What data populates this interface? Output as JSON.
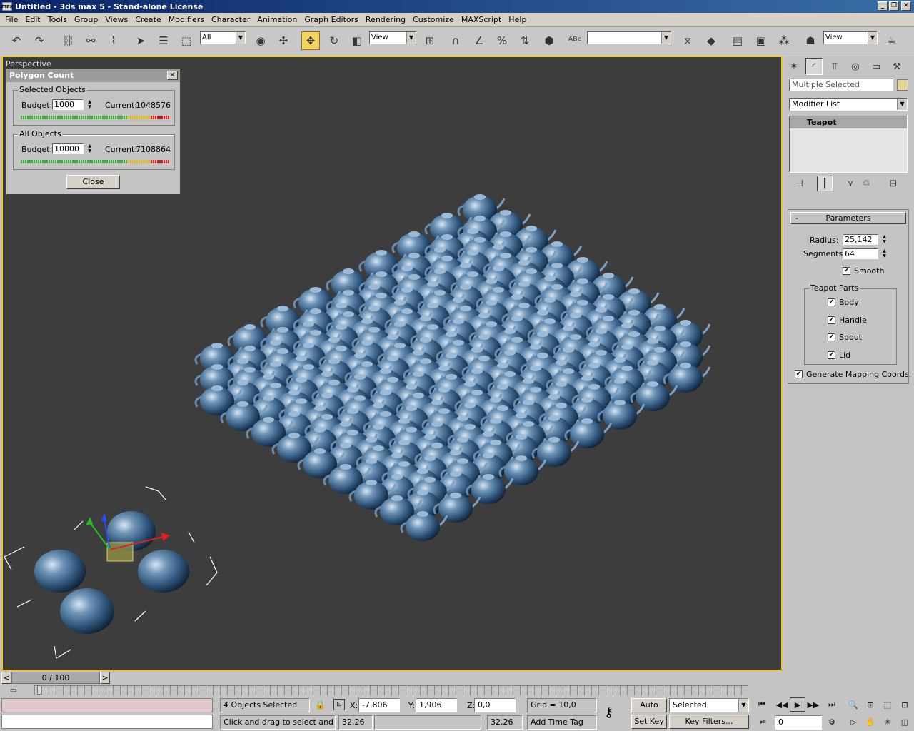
{
  "window": {
    "title": "Untitled - 3ds max 5 - Stand-alone License",
    "app_icon": "max"
  },
  "menu": [
    "File",
    "Edit",
    "Tools",
    "Group",
    "Views",
    "Create",
    "Modifiers",
    "Character",
    "Animation",
    "Graph Editors",
    "Rendering",
    "Customize",
    "MAXScript",
    "Help"
  ],
  "toolbar": {
    "selection_filter": "All",
    "ref_coord": "View",
    "named_selection": "",
    "render_view": "View"
  },
  "viewport": {
    "label": "Perspective",
    "background": "#3d3d3d",
    "border": "#f2c230"
  },
  "polygon_count": {
    "title": "Polygon Count",
    "selected_label": "Selected Objects",
    "selected_budget_label": "Budget:",
    "selected_budget": "1000",
    "selected_current_label": "Current:",
    "selected_current": "1048576",
    "all_label": "All Objects",
    "all_budget_label": "Budget:",
    "all_budget": "10000",
    "all_current_label": "Current:",
    "all_current": "7108864",
    "close_label": "Close"
  },
  "command_panel": {
    "name_field": "Multiple Selected",
    "modifier_list": "Modifier List",
    "stack_item": "Teapot",
    "rollout_toggle": "-",
    "rollout_title": "Parameters",
    "radius_label": "Radius:",
    "radius": "25,142",
    "segments_label": "Segments:",
    "segments": "64",
    "smooth_label": "Smooth",
    "parts_label": "Teapot Parts",
    "parts": [
      "Body",
      "Handle",
      "Spout",
      "Lid"
    ],
    "mapping_label": "Generate Mapping Coords.",
    "check_mark": "✔"
  },
  "timeline": {
    "frame": "0 / 100",
    "prev": "<",
    "next": ">"
  },
  "status": {
    "selection": "4 Objects Selected",
    "prompt": "Click and drag to select and mov",
    "x_label": "X:",
    "x": "-7,806",
    "y_label": "Y:",
    "y": "1,906",
    "z_label": "Z:",
    "z": "0,0",
    "grid": "Grid = 10,0",
    "add_time_tag": "Add Time Tag",
    "value_a": "32,26",
    "value_b": "32,26",
    "auto_key": "Auto Key",
    "set_key": "Set Key",
    "key_mode": "Selected",
    "key_filters": "Key Filters...",
    "current_frame": "0"
  }
}
